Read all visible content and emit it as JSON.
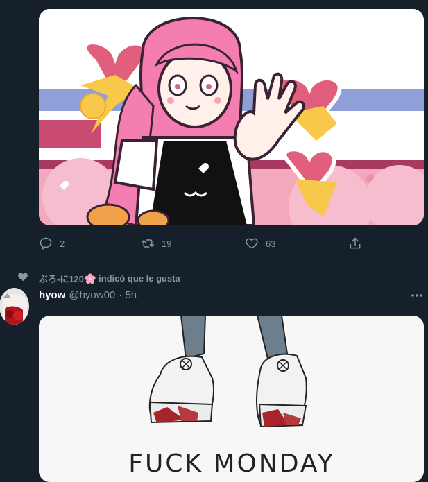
{
  "tweet1": {
    "actions": {
      "reply_count": "2",
      "retweet_count": "19",
      "like_count": "63"
    }
  },
  "social_context": {
    "liker_name": "ぶろ-に120",
    "liked_text": "indicó que le gusta"
  },
  "tweet2": {
    "user_name": "hyow",
    "user_handle": "@hyow00",
    "time": "· 5h",
    "image_text": "FUCK MONDAY"
  },
  "colors": {
    "background": "#15202b",
    "muted": "#8899a6",
    "divider": "#38444d"
  }
}
